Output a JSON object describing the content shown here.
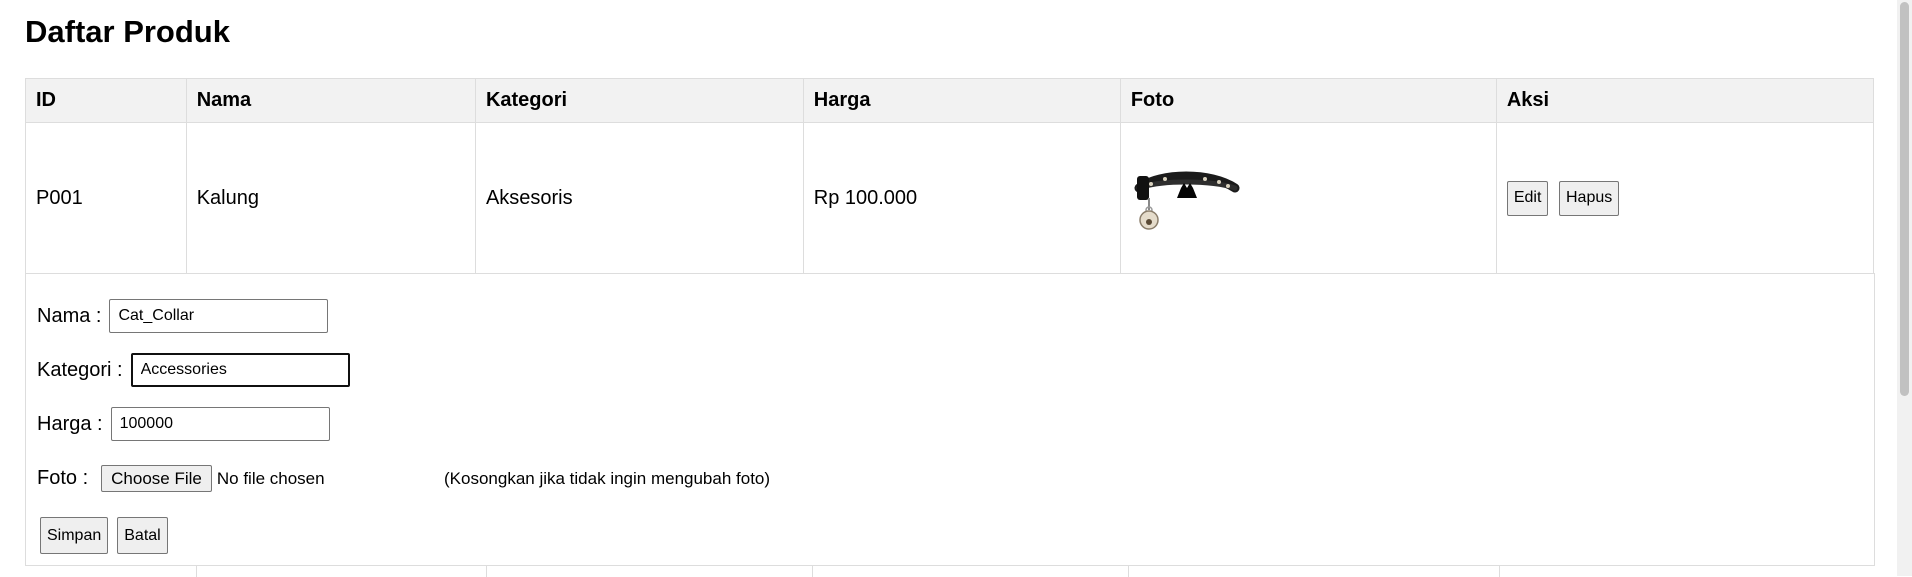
{
  "page": {
    "title": "Daftar Produk"
  },
  "table": {
    "headers": {
      "id": "ID",
      "nama": "Nama",
      "kategori": "Kategori",
      "harga": "Harga",
      "foto": "Foto",
      "aksi": "Aksi"
    },
    "rows": [
      {
        "id": "P001",
        "nama": "Kalung",
        "kategori": "Aksesoris",
        "harga": "Rp 100.000",
        "foto_icon": "cat-collar-photo",
        "edit_label": "Edit",
        "delete_label": "Hapus"
      }
    ]
  },
  "edit_form": {
    "nama_label": "Nama :",
    "nama_value": "Cat_Collar",
    "kategori_label": "Kategori :",
    "kategori_value": "Accessories",
    "harga_label": "Harga :",
    "harga_value": "100000",
    "foto_label": "Foto :",
    "choose_file_label": "Choose File",
    "file_status": "No file chosen",
    "foto_hint": "(Kosongkan jika tidak ingin mengubah foto)",
    "save_label": "Simpan",
    "cancel_label": "Batal"
  },
  "colors": {
    "header_bg": "#f2f2f2",
    "border": "#dddddd",
    "button_bg": "#efefef"
  }
}
